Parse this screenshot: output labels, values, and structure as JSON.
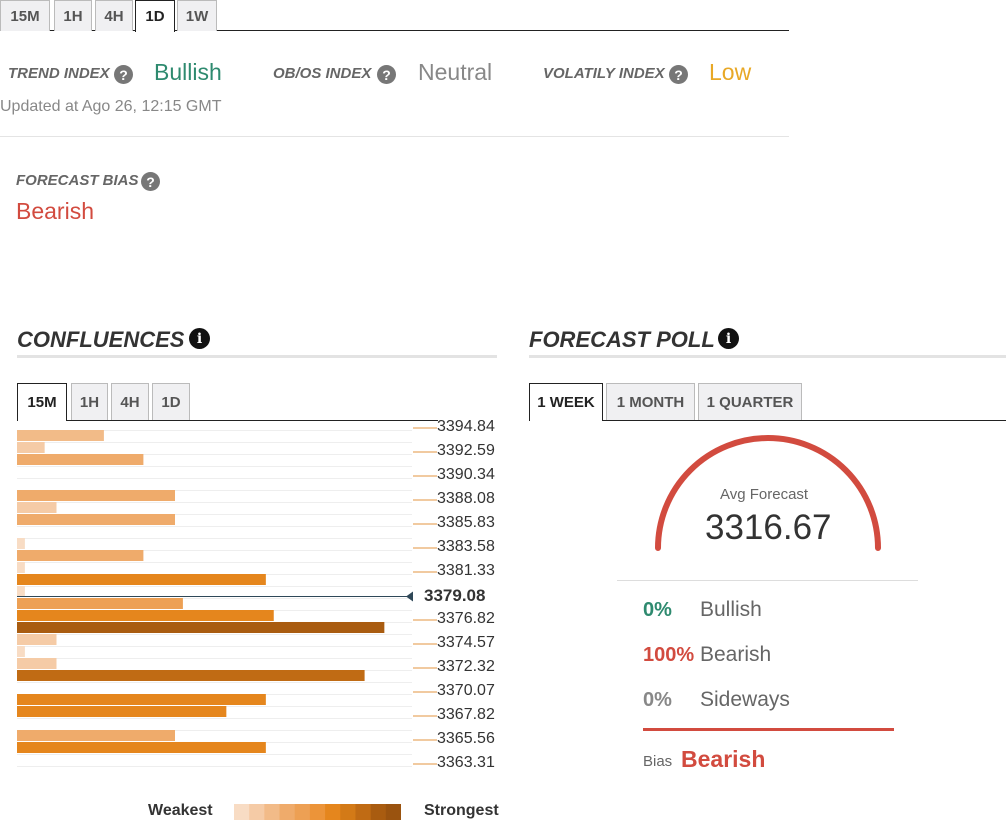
{
  "colors": {
    "bullish": "#2e8a6f",
    "neutral": "#888888",
    "low": "#e8a826",
    "bearish": "#d24b3f",
    "strength_scale": [
      "#f8dcc4",
      "#f5cba6",
      "#f2bb88",
      "#efab6b",
      "#eda054",
      "#ec9439",
      "#e5861d",
      "#d37a17",
      "#c06b14",
      "#a95c10",
      "#9a530f"
    ]
  },
  "timeframe_tabs": [
    {
      "label": "15M",
      "active": false
    },
    {
      "label": "1H",
      "active": false
    },
    {
      "label": "4H",
      "active": false
    },
    {
      "label": "1D",
      "active": true
    },
    {
      "label": "1W",
      "active": false
    }
  ],
  "indexes": {
    "trend": {
      "label": "TREND INDEX",
      "value": "Bullish"
    },
    "obos": {
      "label": "OB/OS INDEX",
      "value": "Neutral"
    },
    "volatility": {
      "label": "VOLATILY INDEX",
      "value": "Low"
    },
    "help_glyph": "?"
  },
  "updated": "Updated at Ago 26, 12:15 GMT",
  "forecast_bias": {
    "label": "FORECAST BIAS",
    "value": "Bearish"
  },
  "confluences": {
    "title": "CONFLUENCES",
    "info_glyph": "i",
    "tabs": [
      {
        "label": "15M",
        "active": true
      },
      {
        "label": "1H",
        "active": false
      },
      {
        "label": "4H",
        "active": false
      },
      {
        "label": "1D",
        "active": false
      }
    ],
    "current_price": "3379.08",
    "legend": {
      "weakest": "Weakest",
      "strongest": "Strongest"
    }
  },
  "chart_data": {
    "type": "bar",
    "orientation": "horizontal",
    "price_labels": [
      "3394.84",
      "3392.59",
      "3390.34",
      "3388.08",
      "3385.83",
      "3383.58",
      "3381.33",
      "3379.08",
      "3376.82",
      "3374.57",
      "3372.32",
      "3370.07",
      "3367.82",
      "3365.56",
      "3363.31"
    ],
    "current_price_index": 7,
    "max_value": 10,
    "bars": [
      {
        "value": 2.2,
        "strength": 2
      },
      {
        "value": 0.7,
        "strength": 1
      },
      {
        "value": 3.2,
        "strength": 3
      },
      {
        "value": 0,
        "strength": 0
      },
      {
        "value": 0,
        "strength": 0
      },
      {
        "value": 4.0,
        "strength": 3
      },
      {
        "value": 1.0,
        "strength": 1
      },
      {
        "value": 4.0,
        "strength": 3
      },
      {
        "value": 0,
        "strength": 0
      },
      {
        "value": 0.2,
        "strength": 0
      },
      {
        "value": 3.2,
        "strength": 3
      },
      {
        "value": 0.2,
        "strength": 0
      },
      {
        "value": 6.3,
        "strength": 6
      },
      {
        "value": 0.2,
        "strength": 0
      },
      {
        "value": 4.2,
        "strength": 4
      },
      {
        "value": 6.5,
        "strength": 6
      },
      {
        "value": 9.3,
        "strength": 9
      },
      {
        "value": 1.0,
        "strength": 1
      },
      {
        "value": 0.2,
        "strength": 0
      },
      {
        "value": 1.0,
        "strength": 1
      },
      {
        "value": 8.8,
        "strength": 8
      },
      {
        "value": 0,
        "strength": 0
      },
      {
        "value": 6.3,
        "strength": 6
      },
      {
        "value": 5.3,
        "strength": 6
      },
      {
        "value": 0,
        "strength": 0
      },
      {
        "value": 4.0,
        "strength": 3
      },
      {
        "value": 6.3,
        "strength": 6
      },
      {
        "value": 0,
        "strength": 0
      }
    ]
  },
  "forecast_poll": {
    "title": "FORECAST POLL",
    "info_glyph": "i",
    "tabs": [
      {
        "label": "1 WEEK",
        "active": true
      },
      {
        "label": "1 MONTH",
        "active": false
      },
      {
        "label": "1 QUARTER",
        "active": false
      }
    ],
    "avg_label": "Avg Forecast",
    "avg_value": "3316.67",
    "rows": [
      {
        "pct": "0%",
        "label": "Bullish",
        "color": "#2e8a6f"
      },
      {
        "pct": "100%",
        "label": "Bearish",
        "color": "#d24b3f"
      },
      {
        "pct": "0%",
        "label": "Sideways",
        "color": "#888888"
      }
    ],
    "bias_label": "Bias",
    "bias_value": "Bearish"
  }
}
